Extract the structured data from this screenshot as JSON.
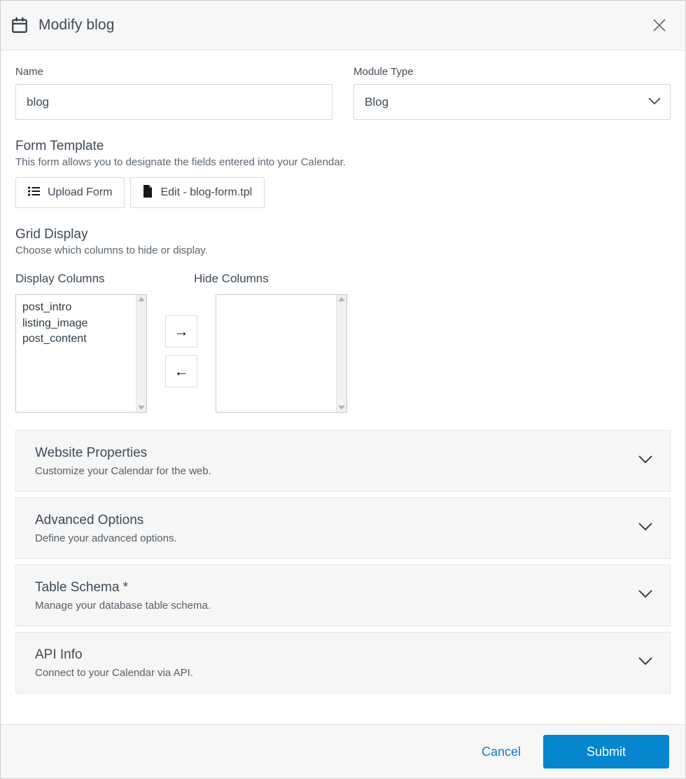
{
  "header": {
    "icon": "calendar-icon",
    "title": "Modify blog",
    "close_icon": "close-icon"
  },
  "form": {
    "name": {
      "label": "Name",
      "value": "blog",
      "placeholder": "Name"
    },
    "module_type": {
      "label": "Module Type",
      "value": "Blog",
      "chevron_icon": "chevron-down-icon"
    }
  },
  "form_template": {
    "title": "Form Template",
    "description": "This form allows you to designate the fields entered into your Calendar.",
    "upload_button": {
      "label": "Upload Form",
      "icon": "list-icon"
    },
    "edit_button": {
      "label": "Edit - blog-form.tpl",
      "icon": "file-icon"
    }
  },
  "grid_display": {
    "title": "Grid Display",
    "description": "Choose which columns to hide or display.",
    "display_columns": {
      "label": "Display Columns",
      "items": [
        "post_intro",
        "listing_image",
        "post_content"
      ]
    },
    "hide_columns": {
      "label": "Hide Columns",
      "items": []
    },
    "move_right_button": {
      "label": "→",
      "icon": "arrow-right-icon"
    },
    "move_left_button": {
      "label": "←",
      "icon": "arrow-left-icon"
    }
  },
  "accordions": [
    {
      "title": "Website Properties",
      "description": "Customize your Calendar for the web.",
      "chevron_icon": "chevron-down-icon"
    },
    {
      "title": "Advanced Options",
      "description": "Define your advanced options.",
      "chevron_icon": "chevron-down-icon"
    },
    {
      "title": "Table Schema *",
      "description": "Manage your database table schema.",
      "chevron_icon": "chevron-down-icon"
    },
    {
      "title": "API Info",
      "description": "Connect to your Calendar via API.",
      "chevron_icon": "chevron-down-icon"
    }
  ],
  "footer": {
    "cancel_label": "Cancel",
    "submit_label": "Submit"
  },
  "colors": {
    "primary": "#0586ce",
    "link": "#0d7fc4",
    "text": "#3e4a57",
    "panel_bg": "#f6f6f6",
    "header_bg": "#f7f7f7"
  }
}
